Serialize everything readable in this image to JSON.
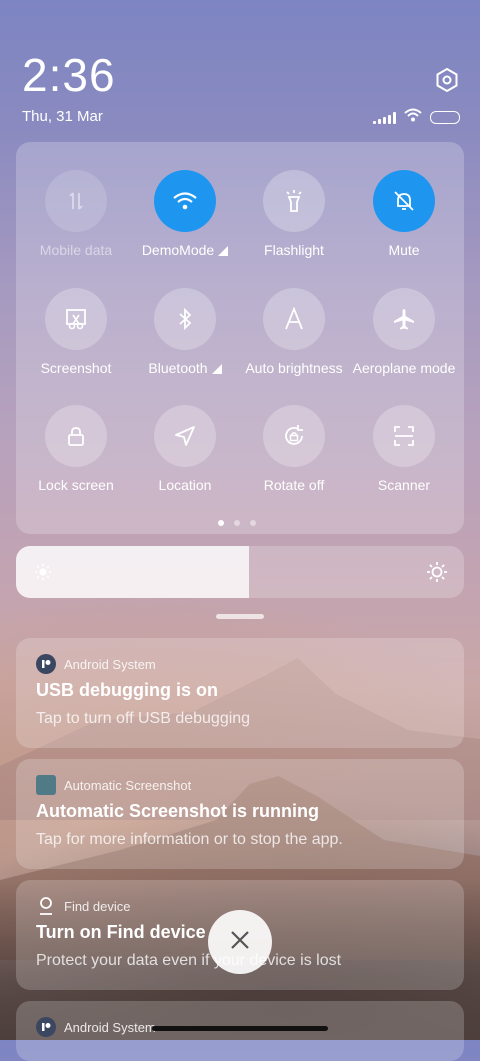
{
  "status": {
    "time": "2:36",
    "date": "Thu, 31 Mar"
  },
  "quick_settings": {
    "tiles": [
      {
        "label": "Mobile data",
        "icon": "mobile-data-icon",
        "state": "disabled"
      },
      {
        "label": "DemoMode",
        "icon": "wifi-icon",
        "state": "on",
        "expand": true
      },
      {
        "label": "Flashlight",
        "icon": "flashlight-icon",
        "state": "off"
      },
      {
        "label": "Mute",
        "icon": "bell-off-icon",
        "state": "on"
      },
      {
        "label": "Screenshot",
        "icon": "screenshot-icon",
        "state": "off"
      },
      {
        "label": "Bluetooth",
        "icon": "bluetooth-icon",
        "state": "off",
        "expand": true
      },
      {
        "label": "Auto brightness",
        "icon": "auto-brightness-icon",
        "state": "off"
      },
      {
        "label": "Aeroplane mode",
        "icon": "airplane-icon",
        "state": "off"
      },
      {
        "label": "Lock screen",
        "icon": "lock-icon",
        "state": "off"
      },
      {
        "label": "Location",
        "icon": "location-icon",
        "state": "off"
      },
      {
        "label": "Rotate off",
        "icon": "rotate-lock-icon",
        "state": "off"
      },
      {
        "label": "Scanner",
        "icon": "scanner-icon",
        "state": "off"
      }
    ],
    "page": 1,
    "page_count": 3
  },
  "brightness": {
    "level": 0.52
  },
  "notifications": [
    {
      "app": "Android System",
      "title": "USB debugging is on",
      "body": "Tap to turn off USB debugging",
      "icon": "android-system-icon"
    },
    {
      "app": "Automatic Screenshot",
      "title": "Automatic Screenshot is running",
      "body": "Tap for more information or to stop the app.",
      "icon": "automatic-screenshot-icon"
    },
    {
      "app": "Find device",
      "title": "Turn on Find device",
      "body": "Protect your data even if your device is lost",
      "icon": "location-pin-icon"
    },
    {
      "app": "Android System",
      "title": "",
      "body": "",
      "icon": "android-system-icon"
    }
  ],
  "colors": {
    "accent": "#1e96f0"
  }
}
